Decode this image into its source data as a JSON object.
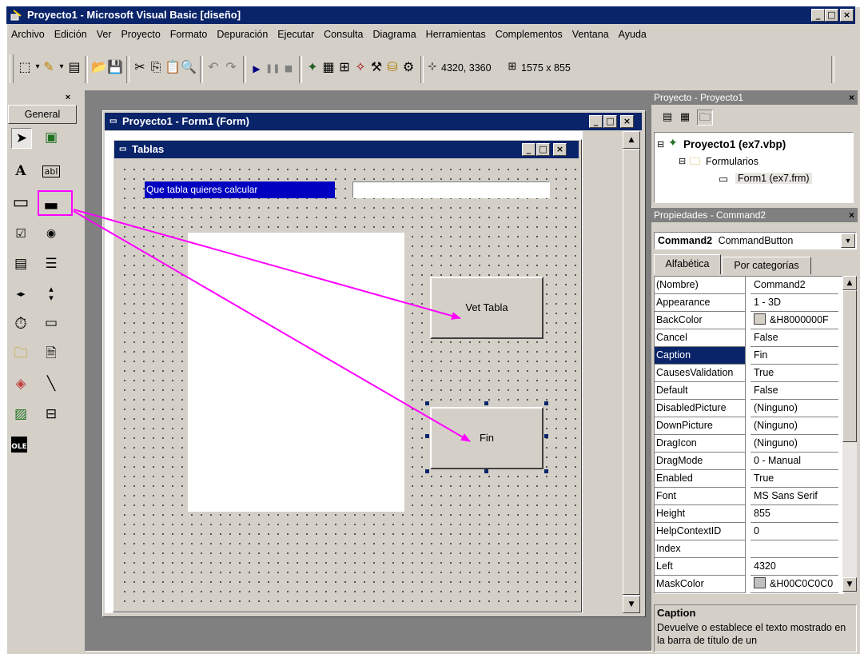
{
  "window": {
    "title": "Proyecto1 - Microsoft Visual Basic [diseño]"
  },
  "menu": [
    "Archivo",
    "Edición",
    "Ver",
    "Proyecto",
    "Formato",
    "Depuración",
    "Ejecutar",
    "Consulta",
    "Diagrama",
    "Herramientas",
    "Complementos",
    "Ventana",
    "Ayuda"
  ],
  "toolbar": {
    "position": "4320, 3360",
    "size": "1575 x 855"
  },
  "toolbox": {
    "tab_label": "General"
  },
  "form_window": {
    "title": "Proyecto1 - Form1 (Form)"
  },
  "form": {
    "title": "Tablas",
    "label_caption": "Que tabla quieres  calcular",
    "button1_caption": "Vet Tabla",
    "button2_caption": "Fin"
  },
  "project_panel": {
    "title": "Proyecto - Proyecto1",
    "tree": {
      "root": "Proyecto1 (ex7.vbp)",
      "folder": "Formularios",
      "item": "Form1 (ex7.frm)"
    }
  },
  "properties_panel": {
    "title": "Propiedades - Command2",
    "object_name": "Command2",
    "object_type": "CommandButton",
    "tabs": [
      "Alfabética",
      "Por categorías"
    ],
    "rows": [
      {
        "name": "(Nombre)",
        "value": "Command2"
      },
      {
        "name": "Appearance",
        "value": "1 - 3D"
      },
      {
        "name": "BackColor",
        "value": "&H8000000F"
      },
      {
        "name": "Cancel",
        "value": "False"
      },
      {
        "name": "Caption",
        "value": "Fin"
      },
      {
        "name": "CausesValidation",
        "value": "True"
      },
      {
        "name": "Default",
        "value": "False"
      },
      {
        "name": "DisabledPicture",
        "value": "(Ninguno)"
      },
      {
        "name": "DownPicture",
        "value": "(Ninguno)"
      },
      {
        "name": "DragIcon",
        "value": "(Ninguno)"
      },
      {
        "name": "DragMode",
        "value": "0 - Manual"
      },
      {
        "name": "Enabled",
        "value": "True"
      },
      {
        "name": "Font",
        "value": "MS Sans Serif"
      },
      {
        "name": "Height",
        "value": "855"
      },
      {
        "name": "HelpContextID",
        "value": "0"
      },
      {
        "name": "Index",
        "value": ""
      },
      {
        "name": "Left",
        "value": "4320"
      },
      {
        "name": "MaskColor",
        "value": "&H00C0C0C0"
      }
    ],
    "description_title": "Caption",
    "description_text": "Devuelve o establece el texto mostrado en la barra de título de un"
  },
  "colors": {
    "titlebar": "#0a246a",
    "face": "#d4d0c8",
    "annotation": "#ff00ff"
  }
}
